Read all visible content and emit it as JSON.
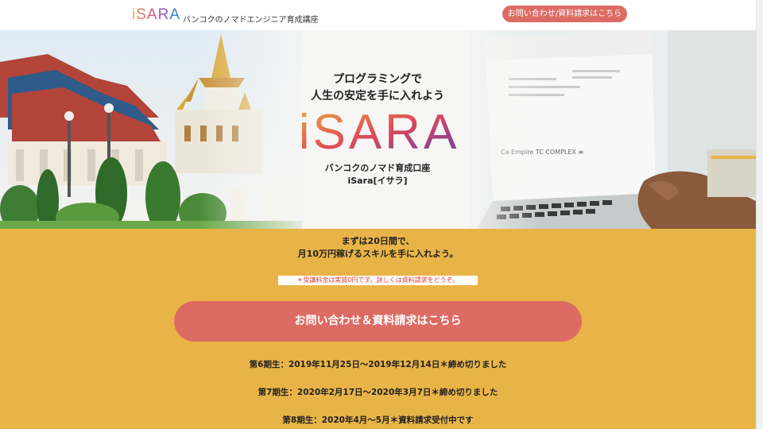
{
  "header": {
    "logo_letters": [
      "i",
      "S",
      "A",
      "R",
      "A"
    ],
    "tagline": "バンコクのノマドエンジニア育成講座",
    "contact_button": "お問い合わせ/資料請求はこちら"
  },
  "hero": {
    "heading_line1": "プログラミングで",
    "heading_line2": "人生の安定を手に入れよう",
    "logo_text": "iSARA",
    "sub_line1": "バンコクのノマド育成口座",
    "sub_line2": "iSara[イサラ]",
    "laptop_screen_text": "Cǝ  Empire  TC  COMPLEX  ≡"
  },
  "main": {
    "intro_line1": "まずは20日間で、",
    "intro_line2": "月10万円稼げるスキルを手に入れよう。",
    "note": "＊受講料金は実質0円です。詳しくは資料請求をどうぞ。",
    "cta_button": "お問い合わせ＆資料請求はこちら",
    "terms": [
      "第6期生：2019年11月25日〜2019年12月14日＊締め切りました",
      "第7期生：2020年2月17日〜2020年3月7日＊締め切りました",
      "第8期生：2020年4月〜5月＊資料請求受付中です"
    ]
  },
  "colors": {
    "accent_button": "#dc6b63",
    "band_background": "#e9b447",
    "note_text": "#e03c31"
  }
}
